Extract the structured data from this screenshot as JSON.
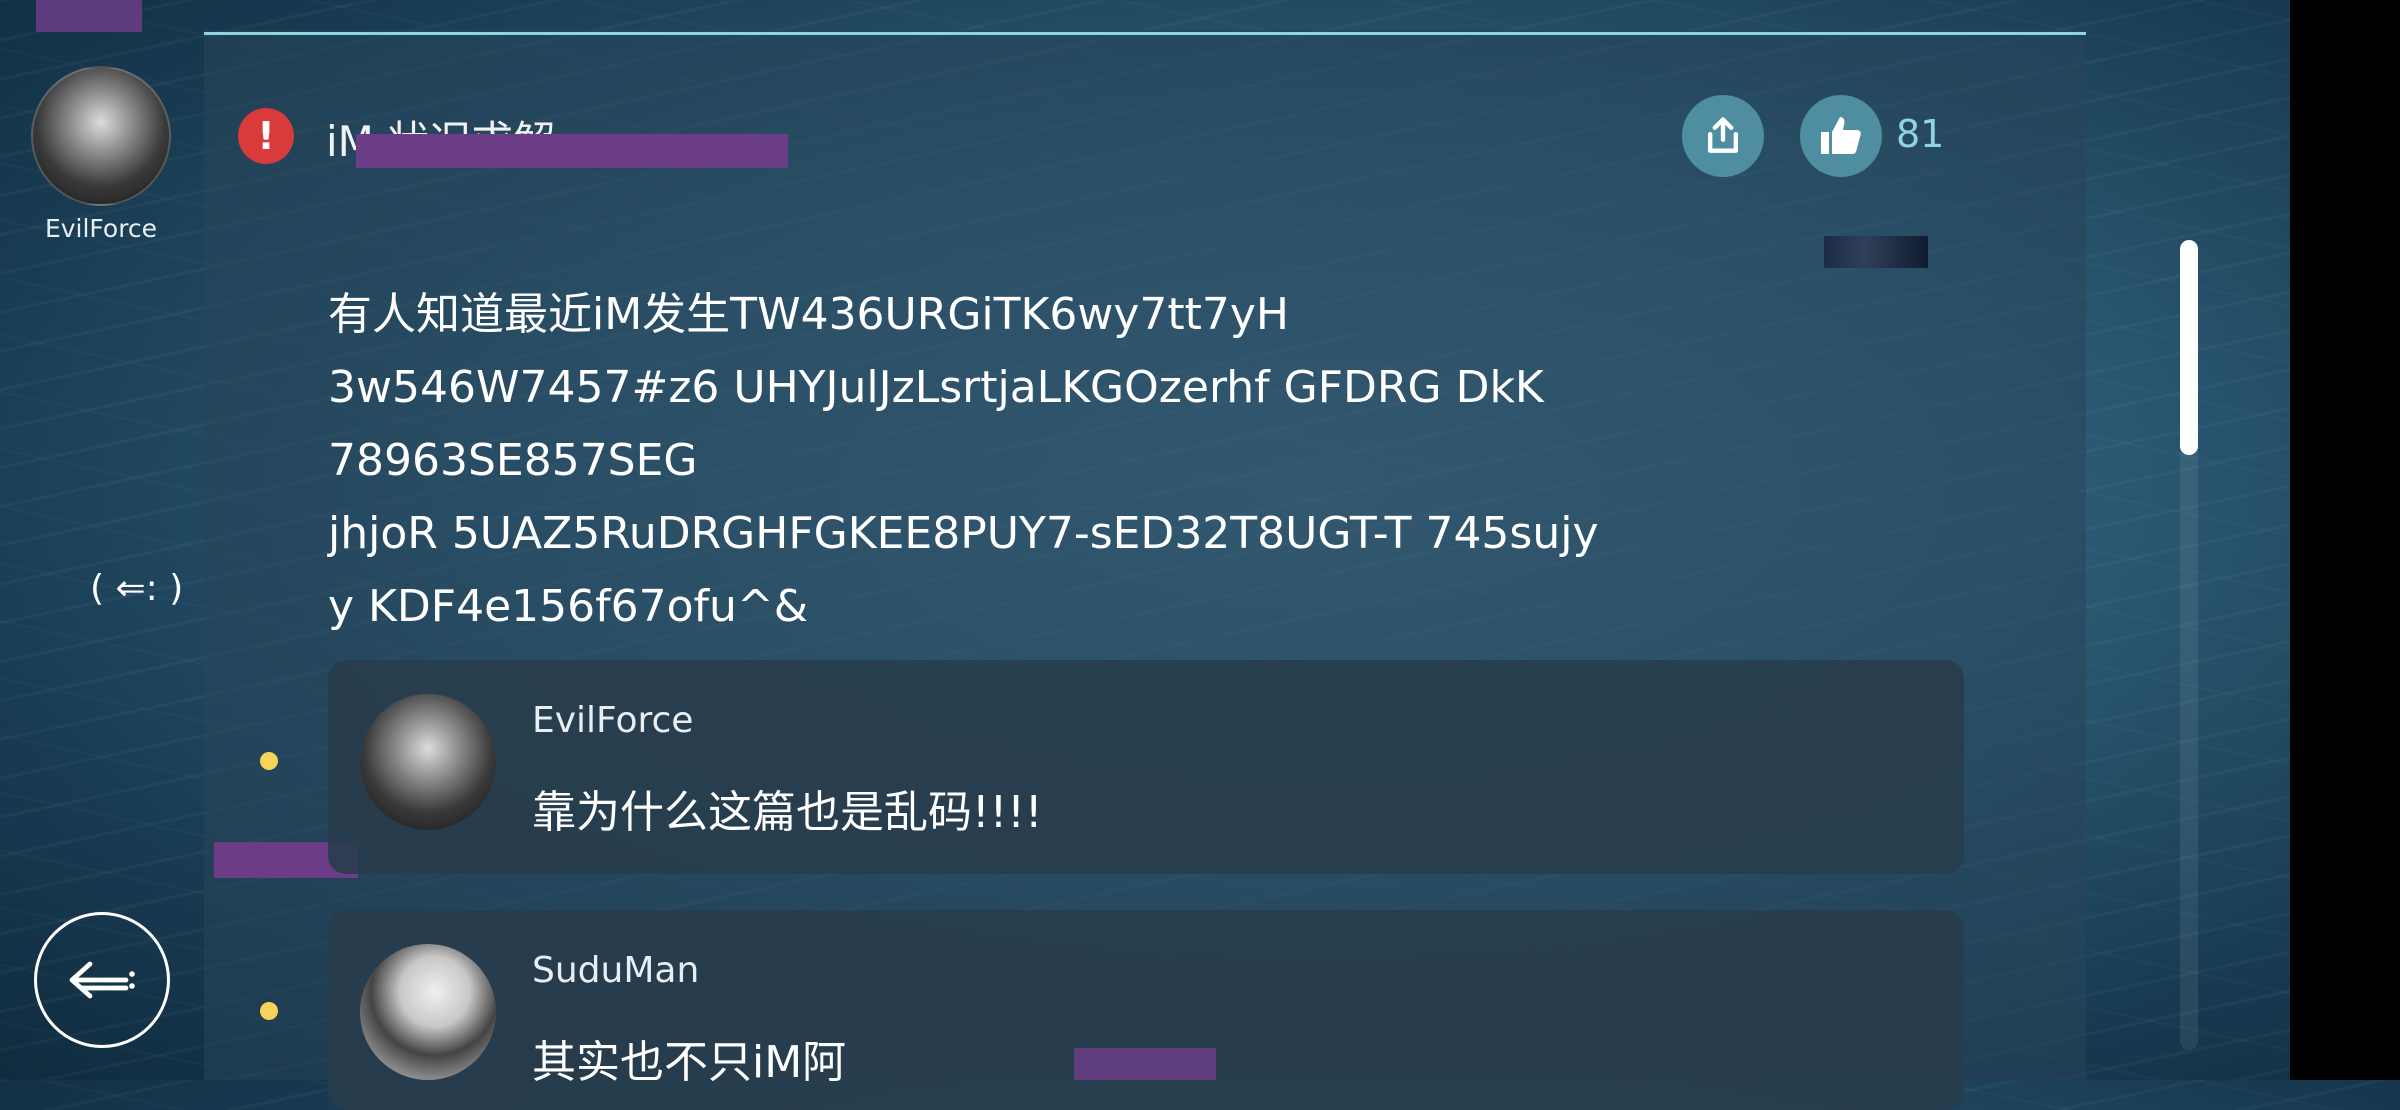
{
  "post": {
    "author": {
      "name": "EvilForce",
      "avatar": "dragon-avatar"
    },
    "title": "iM 状况求解",
    "like_count": "81",
    "body_lines": [
      "有人知道最近iM发生TW436URGiTK6wy7tt7yH",
      "3w546W7457#z6 UHYJulJzLsrtjaLKGOzerhf GFDRG DkK",
      "78963SE857SEG",
      "jhjoR 5UAZ5RuDRGHFGKEE8PUY7-sED32T8UGT-T 745sujy",
      "y KDF4e156f67ofu^&"
    ]
  },
  "side_tag": "( ⇐: )",
  "comments": [
    {
      "user": "EvilForce",
      "text": "靠为什么这篇也是乱码!!!!",
      "avatar": "dragon-avatar"
    },
    {
      "user": "SuduMan",
      "text": "其实也不只iM阿",
      "avatar": "cartoon-man-avatar"
    }
  ],
  "icons": {
    "share": "share-icon",
    "like": "thumbs-up-icon",
    "back": "back-arrow-icon",
    "alert": "exclamation-icon"
  },
  "colors": {
    "accent": "#8fd4e4",
    "alert": "#d93a3a",
    "button": "#4f8da0",
    "dot": "#f5d45a"
  }
}
